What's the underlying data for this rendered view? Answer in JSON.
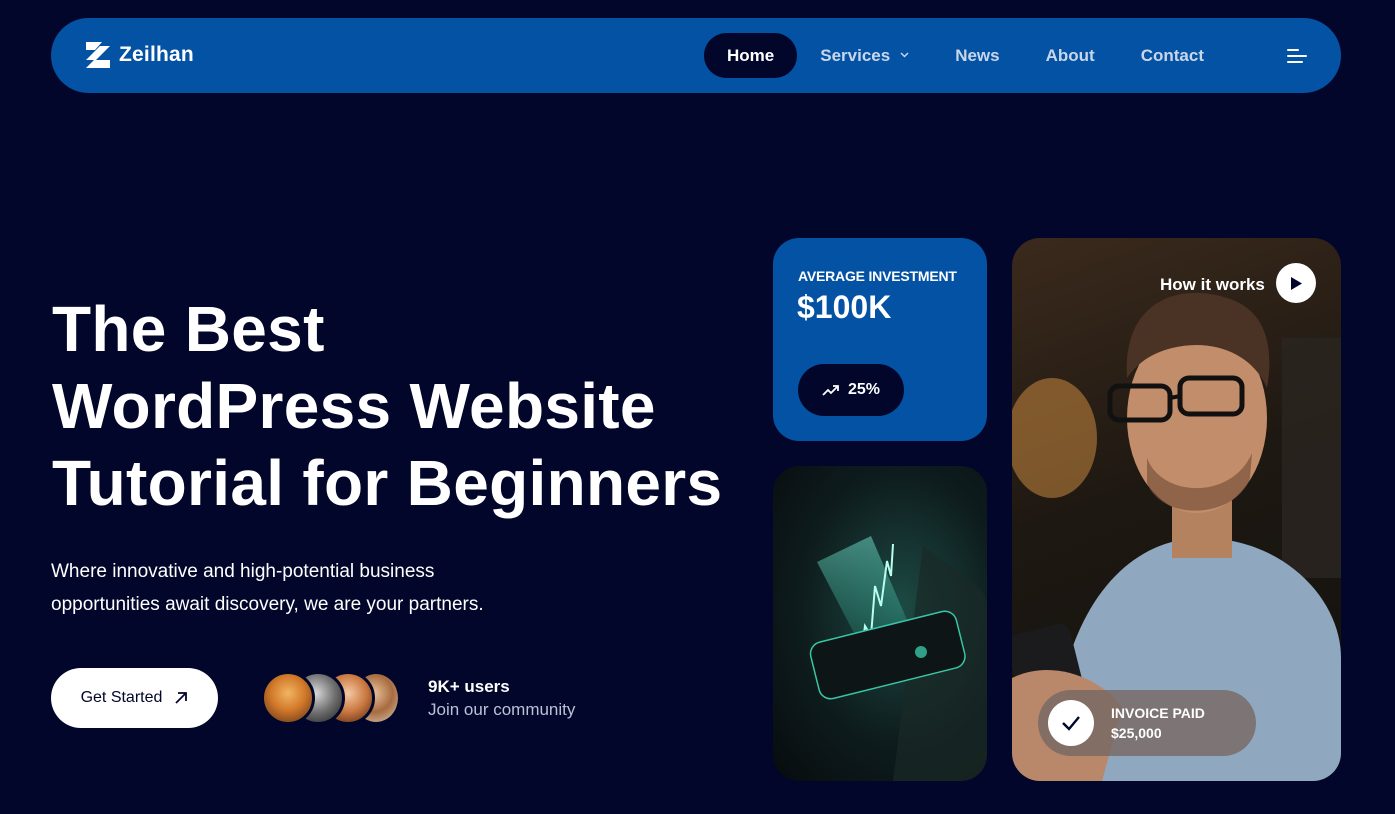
{
  "brand": {
    "name": "Zeilhan",
    "icon": "zeilhan-logo-mark"
  },
  "nav": {
    "items": [
      {
        "label": "Home",
        "active": true
      },
      {
        "label": "Services",
        "has_dropdown": true
      },
      {
        "label": "News"
      },
      {
        "label": "About"
      },
      {
        "label": "Contact"
      }
    ],
    "menu_icon": "hamburger-menu-icon"
  },
  "hero": {
    "title_lines": [
      "The Best",
      "WordPress Website",
      "Tutorial for Beginners"
    ],
    "subtitle_lines": [
      "Where innovative and high-potential business",
      "opportunities await discovery, we are your partners."
    ],
    "cta_label": "Get Started",
    "cta_icon": "arrow-up-right-icon",
    "community": {
      "count": "9K+ users",
      "label": "Join our community"
    }
  },
  "investment_card": {
    "label": "AVERAGE INVESTMENT",
    "value": "$100K",
    "growth": "25%",
    "growth_icon": "trend-up-icon"
  },
  "video_card": {
    "label": "How it works",
    "play_icon": "play-icon"
  },
  "invoice": {
    "label": "INVOICE PAID",
    "value": "$25,000",
    "icon": "check-icon"
  },
  "colors": {
    "background": "#01062a",
    "primary": "#0452a3",
    "text": "#ffffff",
    "muted": "#b8c2d8"
  }
}
